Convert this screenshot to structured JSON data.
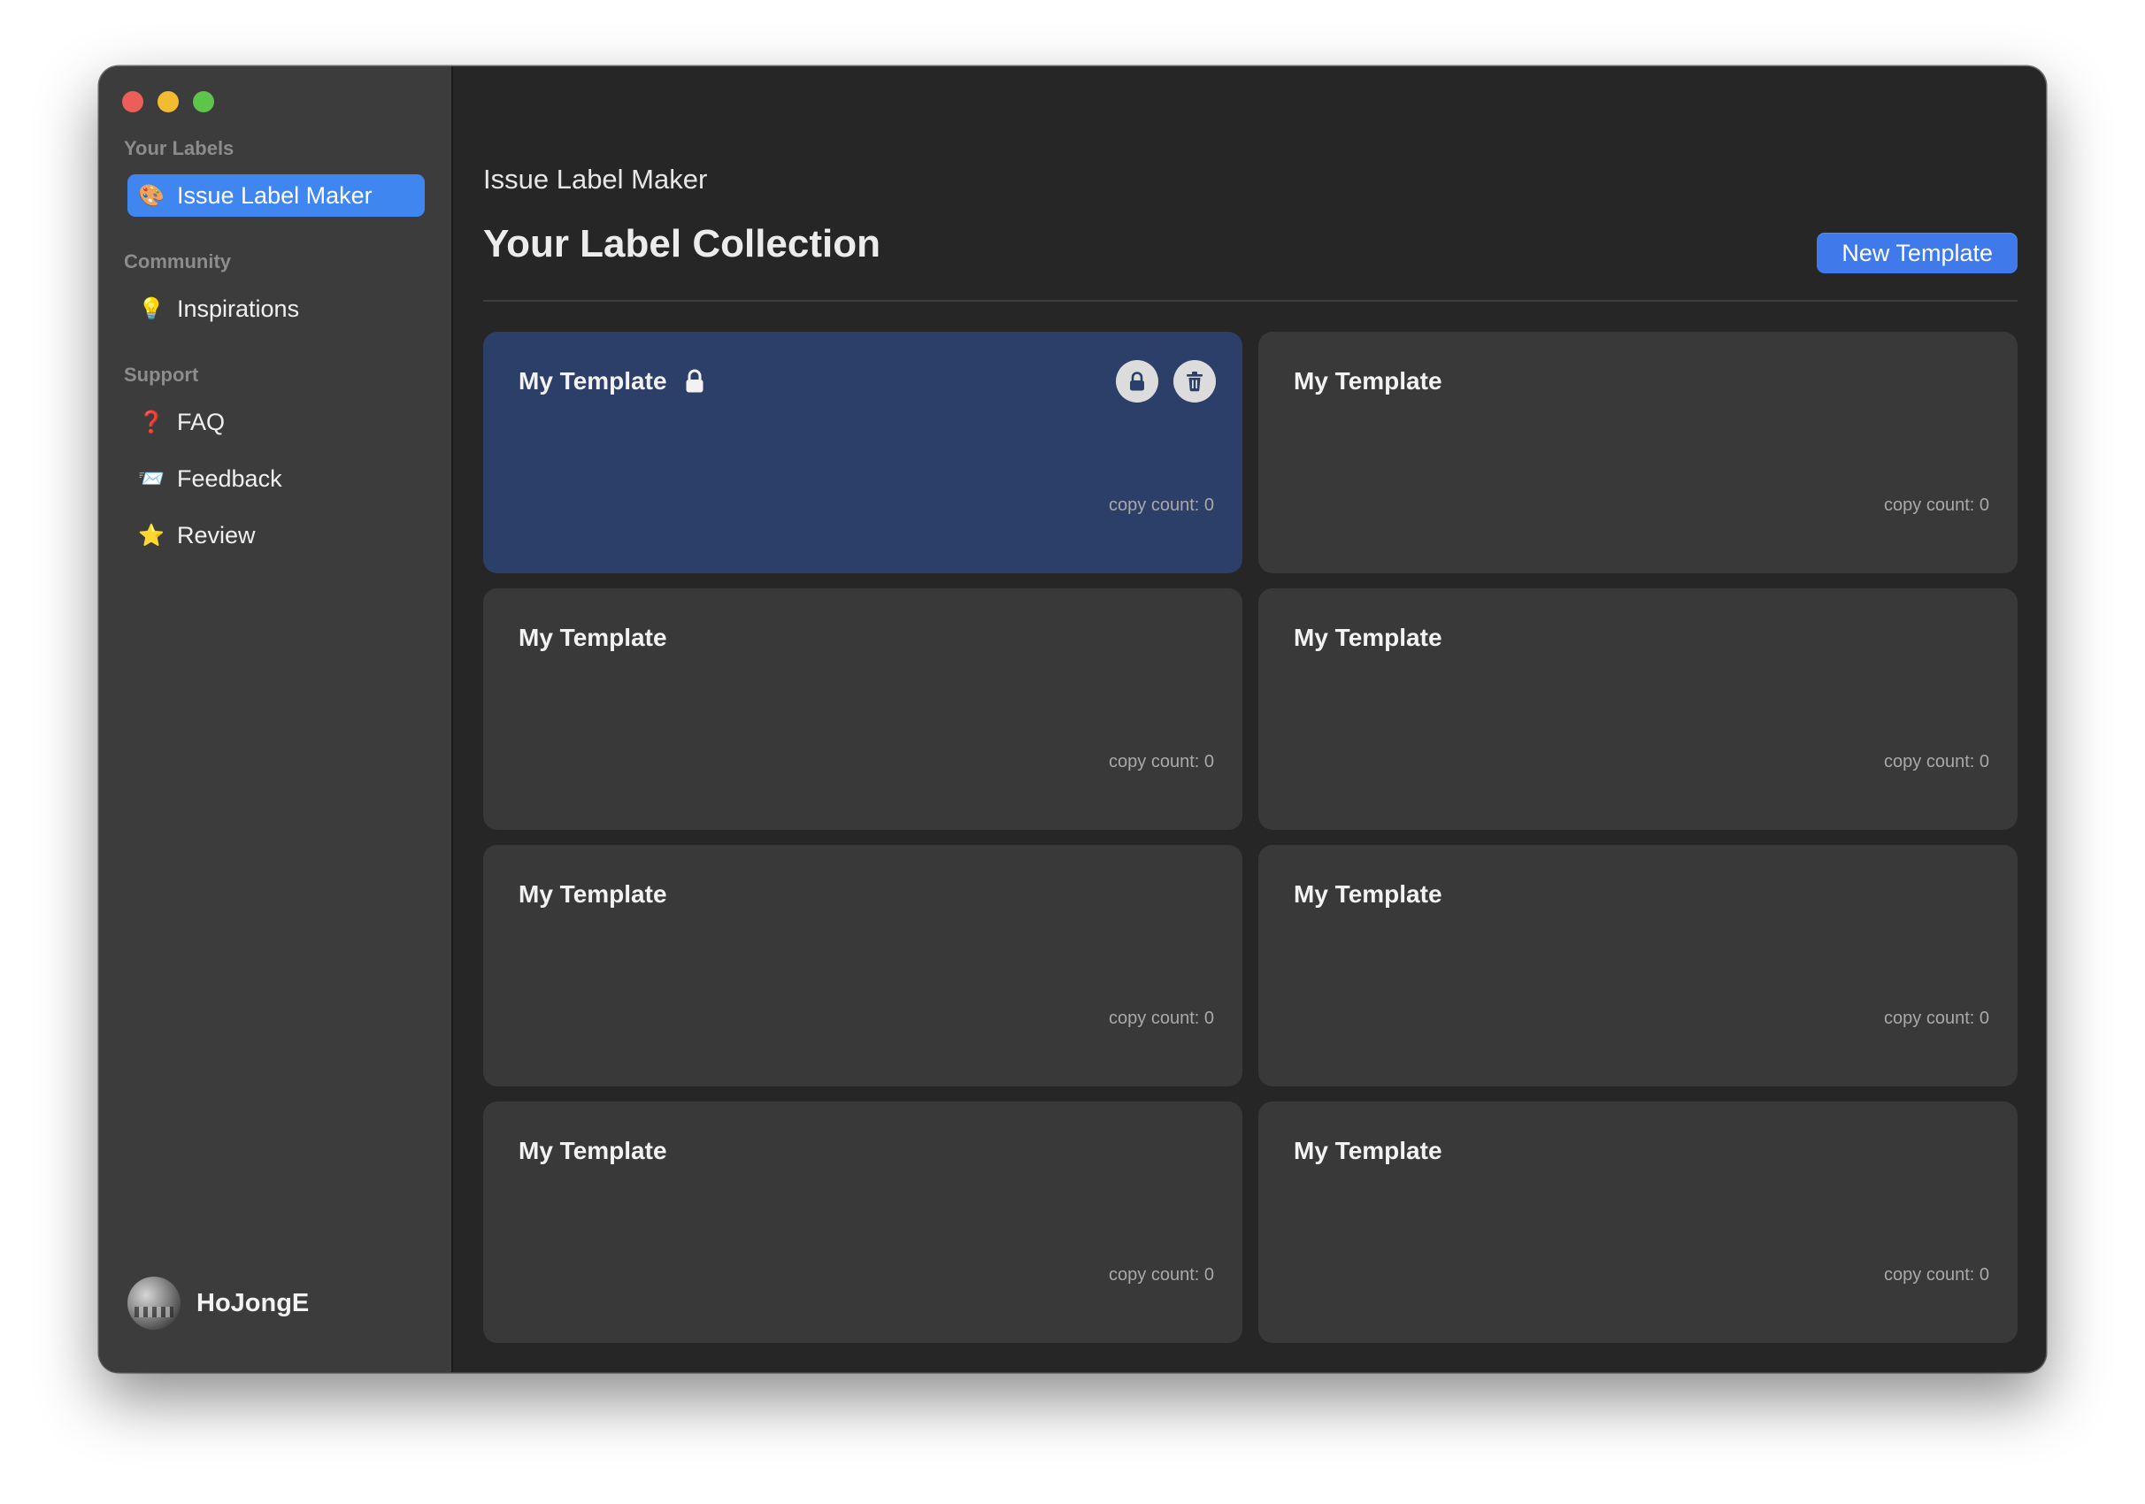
{
  "window": {
    "traffic_lights": [
      "close",
      "minimize",
      "zoom"
    ]
  },
  "sidebar": {
    "sections": [
      {
        "title": "Your Labels",
        "items": [
          {
            "label": "Issue Label Maker",
            "icon": "palette-icon",
            "glyph": "🎨",
            "active": true
          }
        ]
      },
      {
        "title": "Community",
        "items": [
          {
            "label": "Inspirations",
            "icon": "lightbulb-icon",
            "glyph": "💡",
            "active": false
          }
        ]
      },
      {
        "title": "Support",
        "items": [
          {
            "label": "FAQ",
            "icon": "question-mark-icon",
            "glyph": "❓",
            "active": false
          },
          {
            "label": "Feedback",
            "icon": "envelope-icon",
            "glyph": "📨",
            "active": false
          },
          {
            "label": "Review",
            "icon": "star-icon",
            "glyph": "⭐",
            "active": false
          }
        ]
      }
    ],
    "user": {
      "name": "HoJongE"
    }
  },
  "main": {
    "app_title": "Issue Label Maker",
    "page_title": "Your Label Collection",
    "new_button": "New Template",
    "cards": [
      {
        "title": "My Template",
        "copy_count": "copy count: 0",
        "selected": true,
        "locked": true
      },
      {
        "title": "My Template",
        "copy_count": "copy count: 0",
        "selected": false,
        "locked": false
      },
      {
        "title": "My Template",
        "copy_count": "copy count: 0",
        "selected": false,
        "locked": false
      },
      {
        "title": "My Template",
        "copy_count": "copy count: 0",
        "selected": false,
        "locked": false
      },
      {
        "title": "My Template",
        "copy_count": "copy count: 0",
        "selected": false,
        "locked": false
      },
      {
        "title": "My Template",
        "copy_count": "copy count: 0",
        "selected": false,
        "locked": false
      },
      {
        "title": "My Template",
        "copy_count": "copy count: 0",
        "selected": false,
        "locked": false
      },
      {
        "title": "My Template",
        "copy_count": "copy count: 0",
        "selected": false,
        "locked": false
      }
    ]
  },
  "colors": {
    "accent": "#3f86f1",
    "button": "#3f79ea",
    "selected_card": "#2c3f68",
    "card": "#393939",
    "sidebar": "#3c3c3c",
    "content": "#262626"
  }
}
